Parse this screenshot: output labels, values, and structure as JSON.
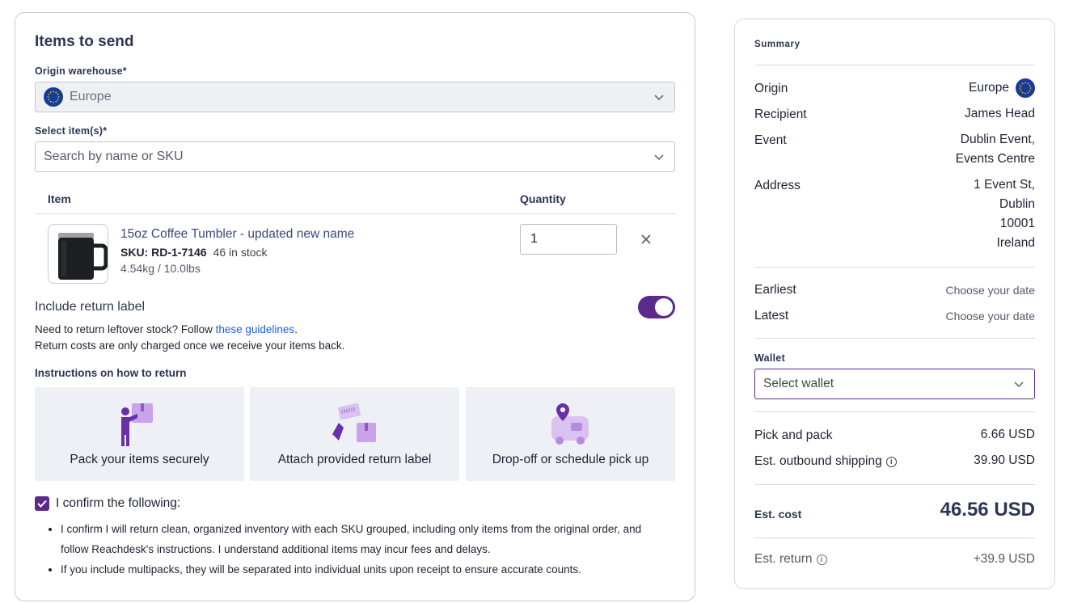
{
  "items_card": {
    "title": "Items to send",
    "origin_label": "Origin warehouse*",
    "origin_value": "Europe",
    "select_label": "Select item(s)*",
    "select_placeholder": "Search by name or SKU",
    "table_headers": {
      "item": "Item",
      "quantity": "Quantity"
    },
    "item": {
      "name": "15oz Coffee Tumbler - updated new name",
      "sku_label": "SKU: RD-1-7146",
      "stock": "46 in stock",
      "weight": "4.54kg / 10.0lbs",
      "quantity": "1"
    },
    "return_label": {
      "title": "Include return label",
      "enabled": true,
      "text_prefix": "Need to return leftover stock? Follow ",
      "link": "these guidelines",
      "text_suffix": ".",
      "note": "Return costs are only charged once we receive your items back."
    },
    "instructions_title": "Instructions on how to return",
    "steps": [
      {
        "label": "Pack your items securely",
        "icon": "pack-icon"
      },
      {
        "label": "Attach provided return label",
        "icon": "label-icon"
      },
      {
        "label": "Drop-off or schedule pick up",
        "icon": "truck-icon"
      }
    ],
    "confirm": {
      "label": "I confirm the following:",
      "checked": true,
      "bullets": [
        "I confirm I will return clean, organized inventory with each SKU grouped, including only items from the original order, and follow Reachdesk's instructions. I understand additional items may incur fees and delays.",
        "If you include multipacks, they will be separated into individual units upon receipt to ensure accurate counts."
      ]
    }
  },
  "summary": {
    "title": "Summary",
    "origin_label": "Origin",
    "origin_value": "Europe",
    "recipient_label": "Recipient",
    "recipient_value": "James Head",
    "event_label": "Event",
    "event_line1": "Dublin Event,",
    "event_line2": "Events Centre",
    "address_label": "Address",
    "address_lines": [
      "1 Event St,",
      "Dublin",
      "10001",
      "Ireland"
    ],
    "earliest_label": "Earliest",
    "earliest_value": "Choose your date",
    "latest_label": "Latest",
    "latest_value": "Choose your date",
    "wallet_label": "Wallet",
    "wallet_placeholder": "Select wallet",
    "pick_pack_label": "Pick and pack",
    "pick_pack_value": "6.66 USD",
    "shipping_label": "Est. outbound shipping",
    "shipping_value": "39.90 USD",
    "est_cost_label": "Est. cost",
    "est_cost_value": "46.56 USD",
    "est_return_label": "Est. return",
    "est_return_value": "+39.9 USD"
  },
  "colors": {
    "accent": "#5b2a8a",
    "link": "#1a5fd6",
    "heading": "#2c3553",
    "eu_blue": "#173b9b"
  }
}
